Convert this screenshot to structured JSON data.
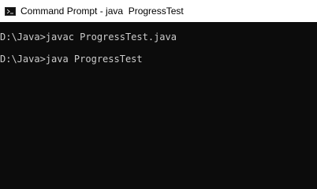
{
  "window": {
    "title": "Command Prompt - java  ProgressTest",
    "icon": "cmd-icon",
    "titlebar_color": "#ffffff",
    "background_color": "#0c0c0c",
    "text_color": "#cccccc"
  },
  "console": {
    "lines": [
      "D:\\Java>javac ProgressTest.java",
      "D:\\Java>java ProgressTest"
    ]
  }
}
